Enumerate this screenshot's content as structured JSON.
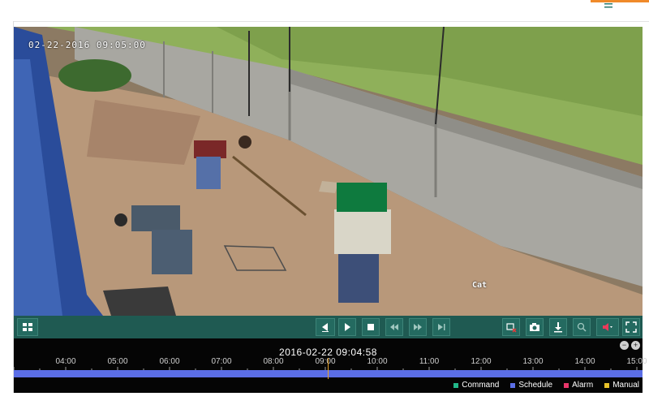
{
  "osd": {
    "timestamp": "02-22-2016   09:05:00",
    "detection_label": "Cat"
  },
  "toolbar": {
    "buttons": [
      {
        "name": "layout-grid-button",
        "icon": "grid-icon"
      },
      {
        "name": "slow-reverse-button",
        "icon": "step-back-icon"
      },
      {
        "name": "play-button",
        "icon": "play-icon"
      },
      {
        "name": "stop-button",
        "icon": "stop-icon"
      },
      {
        "name": "rewind-button",
        "icon": "rewind-icon"
      },
      {
        "name": "fast-forward-button",
        "icon": "fast-forward-icon"
      },
      {
        "name": "next-frame-button",
        "icon": "skip-forward-icon"
      },
      {
        "name": "clip-cancel-button",
        "icon": "clip-cancel-icon"
      },
      {
        "name": "snapshot-button",
        "icon": "camera-icon"
      },
      {
        "name": "download-button",
        "icon": "download-icon"
      },
      {
        "name": "digital-zoom-button",
        "icon": "zoom-icon"
      },
      {
        "name": "audio-button",
        "icon": "speaker-muted-icon"
      },
      {
        "name": "fullscreen-button",
        "icon": "fullscreen-icon"
      }
    ]
  },
  "timeline": {
    "current_time": "2016-02-22 09:04:58",
    "hours": [
      "04:00",
      "05:00",
      "06:00",
      "07:00",
      "08:00",
      "09:00",
      "10:00",
      "11:00",
      "12:00",
      "13:00",
      "14:00",
      "15:00"
    ],
    "recording_type": "Schedule",
    "colors": {
      "bar": "#5b6ee6",
      "cursor": "#e8a22a"
    },
    "zoom_out_label": "−",
    "zoom_in_label": "+"
  },
  "legend": [
    {
      "label": "Command",
      "color": "#22b889"
    },
    {
      "label": "Schedule",
      "color": "#5b6ee6"
    },
    {
      "label": "Alarm",
      "color": "#e8366a"
    },
    {
      "label": "Manual",
      "color": "#e8c22a"
    }
  ]
}
